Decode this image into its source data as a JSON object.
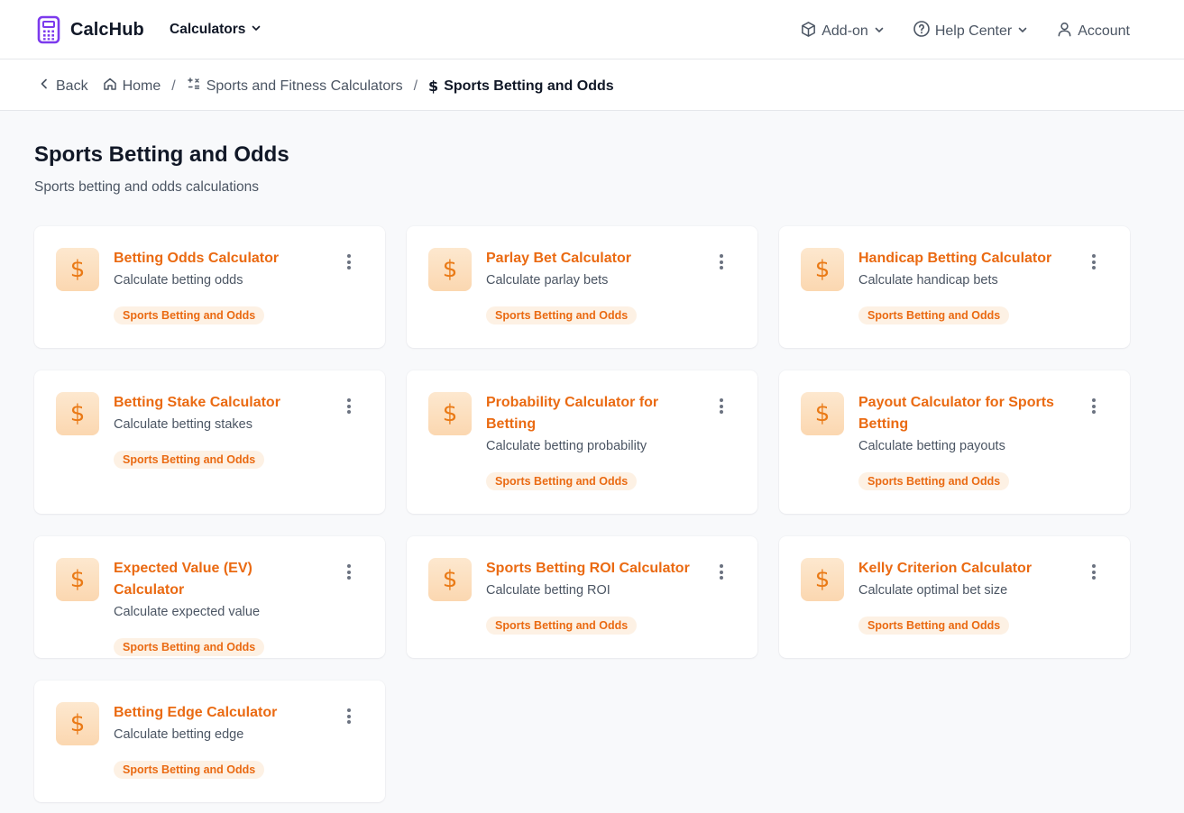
{
  "header": {
    "brand": "CalcHub",
    "nav_calculators": "Calculators",
    "addon": "Add-on",
    "help_center": "Help Center",
    "account": "Account"
  },
  "breadcrumb": {
    "back": "Back",
    "home": "Home",
    "category": "Sports and Fitness Calculators",
    "current": "Sports Betting and Odds"
  },
  "page": {
    "title": "Sports Betting and Odds",
    "subtitle": "Sports betting and odds calculations"
  },
  "icon_symbol": "$",
  "colors": {
    "accent": "#ea6a12",
    "brand_icon": "#7c3aed",
    "tag_bg": "#fdf1e4",
    "icon_bg": "#fde8cf"
  },
  "cards": [
    {
      "title": "Betting Odds Calculator",
      "desc": "Calculate betting odds",
      "tag": "Sports Betting and Odds"
    },
    {
      "title": "Parlay Bet Calculator",
      "desc": "Calculate parlay bets",
      "tag": "Sports Betting and Odds"
    },
    {
      "title": "Handicap Betting Calculator",
      "desc": "Calculate handicap bets",
      "tag": "Sports Betting and Odds"
    },
    {
      "title": "Betting Stake Calculator",
      "desc": "Calculate betting stakes",
      "tag": "Sports Betting and Odds"
    },
    {
      "title": "Probability Calculator for Betting",
      "desc": "Calculate betting probability",
      "tag": "Sports Betting and Odds"
    },
    {
      "title": "Payout Calculator for Sports Betting",
      "desc": "Calculate betting payouts",
      "tag": "Sports Betting and Odds"
    },
    {
      "title": "Expected Value (EV) Calculator",
      "desc": "Calculate expected value",
      "tag": "Sports Betting and Odds"
    },
    {
      "title": "Sports Betting ROI Calculator",
      "desc": "Calculate betting ROI",
      "tag": "Sports Betting and Odds"
    },
    {
      "title": "Kelly Criterion Calculator",
      "desc": "Calculate optimal bet size",
      "tag": "Sports Betting and Odds"
    },
    {
      "title": "Betting Edge Calculator",
      "desc": "Calculate betting edge",
      "tag": "Sports Betting and Odds"
    }
  ]
}
